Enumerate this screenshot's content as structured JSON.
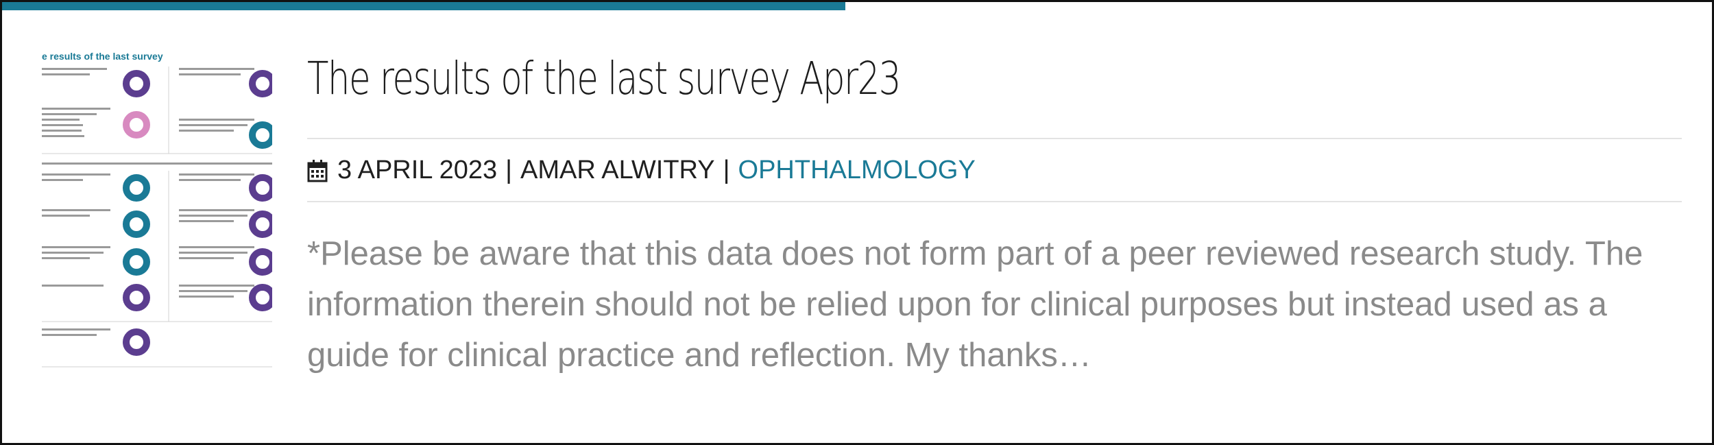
{
  "post": {
    "title": "The results of the last survey Apr23",
    "date": "3 APRIL 2023",
    "author": "AMAR ALWITRY",
    "category": "OPHTHALMOLOGY",
    "separator": "|",
    "excerpt": "*Please be aware that this data does not form part of a peer reviewed research study. The information therein should not be relied upon for clinical purposes but instead used as a guide for clinical practice and reflection. My thanks…",
    "thumbnail_heading": "e results of the last survey"
  },
  "colors": {
    "accent": "#1a7a96",
    "donut_purple": "#5b3d8f",
    "donut_teal": "#1a7a96",
    "donut_pink": "#d88ac0"
  },
  "icons": {
    "meta_date": "calendar-icon"
  }
}
